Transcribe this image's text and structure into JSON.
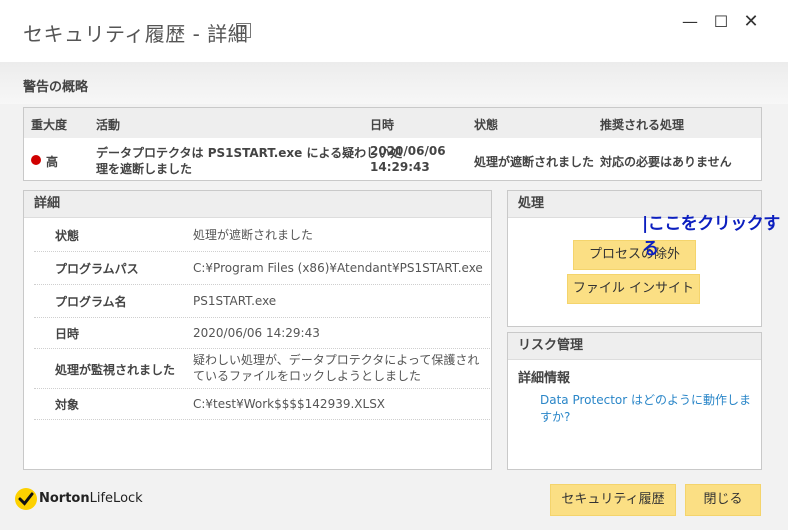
{
  "window": {
    "title": "セキュリティ履歴 - 詳細",
    "help": "?",
    "minimize": "—",
    "maximize": "☐",
    "close": "✕"
  },
  "summary": {
    "title": "警告の概略",
    "headers": [
      "重大度",
      "活動",
      "日時",
      "状態",
      "推奨される処理"
    ],
    "row": {
      "severity": "高",
      "severity_color": "#d00000",
      "activity_line1": "データプロテクタは PS1START.exe による疑わしい処",
      "activity_line2": "理を遮断しました",
      "date": "2020/06/06",
      "time": "14:29:43",
      "status": "処理が遮断されました",
      "recommended": "対応の必要はありません"
    }
  },
  "details": {
    "title": "詳細",
    "rows": [
      {
        "label": "状態",
        "value": "処理が遮断されました"
      },
      {
        "label": "プログラムパス",
        "value": "C:¥Program Files (x86)¥Atendant¥PS1START.exe"
      },
      {
        "label": "プログラム名",
        "value": "PS1START.exe"
      },
      {
        "label": "日時",
        "value": "2020/06/06 14:29:43"
      },
      {
        "label": "処理が監視されました",
        "value": "疑わしい処理が、データプロテクタによって保護されているファイルをロックしようとしました"
      },
      {
        "label": "対象",
        "value": "C:¥test¥Work$$$$142939.XLSX"
      }
    ]
  },
  "actions": {
    "title": "処理",
    "exclude_process": "プロセスの除外",
    "file_insight": "ファイル インサイト",
    "annotation": "|ここをクリックする"
  },
  "risk": {
    "title": "リスク管理",
    "subtitle": "詳細情報",
    "link": "Data Protector はどのように動作しますか?"
  },
  "footer": {
    "logo_bold": "Norton",
    "logo_light": "LifeLock",
    "history_button": "セキュリティ履歴",
    "close_button": "閉じる"
  },
  "colors": {
    "accent_button": "#fbdf84",
    "link": "#2a86c8",
    "annotation": "#0c1fbf",
    "logo": "#fdd100"
  }
}
